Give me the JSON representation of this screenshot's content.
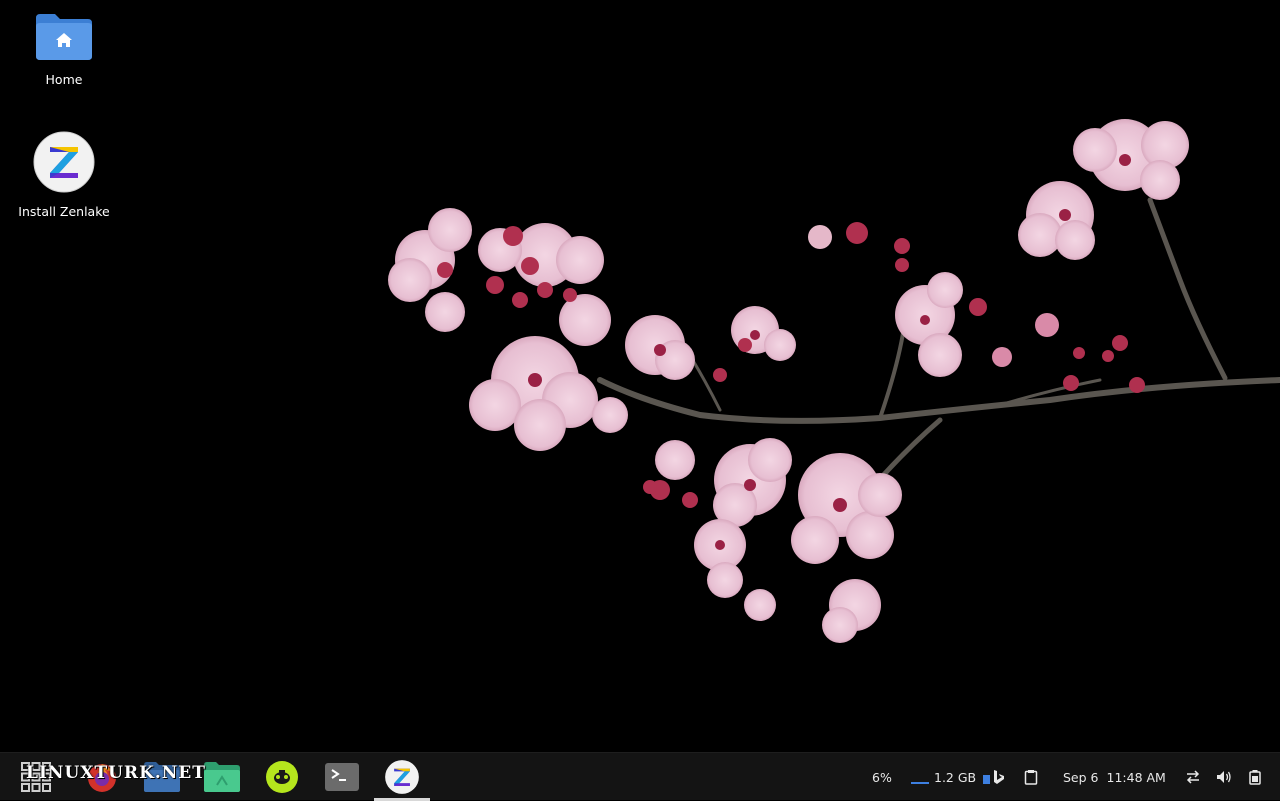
{
  "desktop": {
    "icons": [
      {
        "label": "Home",
        "icon": "home-folder-icon"
      },
      {
        "label": "Install Zenlake",
        "icon": "zenlake-logo-icon"
      }
    ]
  },
  "taskbar": {
    "watermark": "LINUXTURK.NET",
    "apps": [
      {
        "name": "app-menu",
        "icon": "app-grid-icon"
      },
      {
        "name": "firefox",
        "icon": "firefox-icon"
      },
      {
        "name": "files",
        "icon": "folder-icon"
      },
      {
        "name": "file-manager",
        "icon": "green-folder-icon"
      },
      {
        "name": "software",
        "icon": "software-store-icon"
      },
      {
        "name": "terminal",
        "icon": "terminal-icon"
      },
      {
        "name": "zenlake-installer",
        "icon": "zenlake-logo-icon",
        "active": true
      }
    ],
    "tray": {
      "cpu": "6%",
      "memory": "1.2 GB",
      "date": "Sep 6",
      "time": "11:48 AM"
    }
  },
  "colors": {
    "taskbar_bg": "#141414",
    "folder_blue": "#4a8fe0",
    "software_green": "#b5e61d"
  }
}
